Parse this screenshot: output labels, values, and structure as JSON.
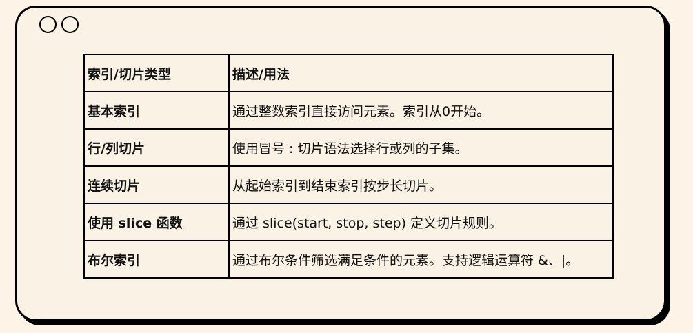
{
  "window": {
    "controls": [
      "circle-button",
      "circle-button"
    ]
  },
  "table": {
    "headers": [
      "索引/切片类型",
      "描述/用法"
    ],
    "rows": [
      {
        "type": "基本索引",
        "description": "通过整数索引直接访问元素。索引从0开始。"
      },
      {
        "type": "行/列切片",
        "description": "使用冒号 : 切片语法选择行或列的子集。"
      },
      {
        "type": "连续切片",
        "description": "从起始索引到结束索引按步长切片。"
      },
      {
        "type": "使用 slice 函数",
        "description": "通过 slice(start, stop, step) 定义切片规则。"
      },
      {
        "type": "布尔索引",
        "description": "通过布尔条件筛选满足条件的元素。支持逻辑运算符 &、|。"
      }
    ]
  },
  "colors": {
    "page_background": "#fdf3e6",
    "card_background": "#faf2e4",
    "border": "#000000",
    "text": "#111111"
  }
}
